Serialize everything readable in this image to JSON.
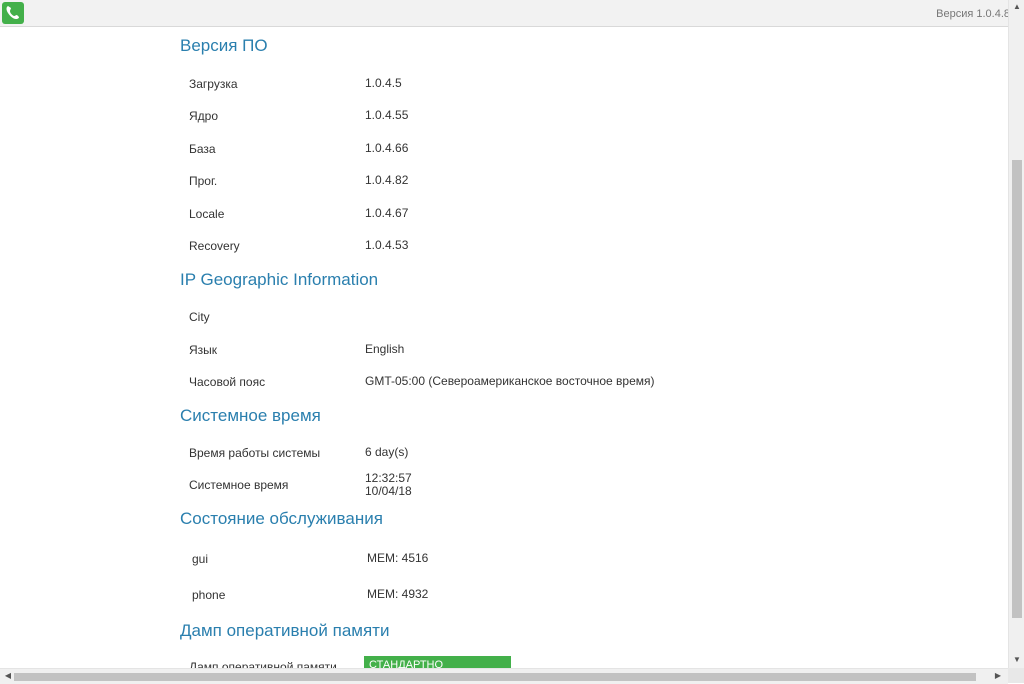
{
  "header": {
    "version_label": "Версия 1.0.4.8",
    "logo_icon": "phone-handset-icon",
    "logo_color": "#43b04a"
  },
  "sections": {
    "firmware": {
      "title": "Версия ПО",
      "rows": [
        {
          "label": "Загрузка",
          "value": "1.0.4.5"
        },
        {
          "label": "Ядро",
          "value": "1.0.4.55"
        },
        {
          "label": "База",
          "value": "1.0.4.66"
        },
        {
          "label": "Прог.",
          "value": "1.0.4.82"
        },
        {
          "label": "Locale",
          "value": "1.0.4.67"
        },
        {
          "label": "Recovery",
          "value": "1.0.4.53"
        }
      ]
    },
    "geo": {
      "title": "IP Geographic Information",
      "rows": [
        {
          "label": "City",
          "value": ""
        },
        {
          "label": "Язык",
          "value": "English"
        },
        {
          "label": "Часовой пояс",
          "value": "GMT-05:00 (Североамериканское восточное время)"
        }
      ]
    },
    "system_time": {
      "title": "Системное время",
      "uptime_label": "Время работы системы",
      "uptime_value": "6 day(s)",
      "time_label": "Системное время",
      "time_value": "12:32:57",
      "date_value": "10/04/18"
    },
    "service": {
      "title": "Состояние обслуживания",
      "rows": [
        {
          "label": "gui",
          "value": "MEM: 4516"
        },
        {
          "label": "phone",
          "value": "MEM: 4932"
        }
      ]
    },
    "memdump": {
      "title": "Дамп оперативной памяти",
      "label": "Дамп оперативной памяти",
      "button_label": "СТАНДАРТНО"
    }
  },
  "colors": {
    "accent": "#2a7fae",
    "button": "#43b04a"
  }
}
